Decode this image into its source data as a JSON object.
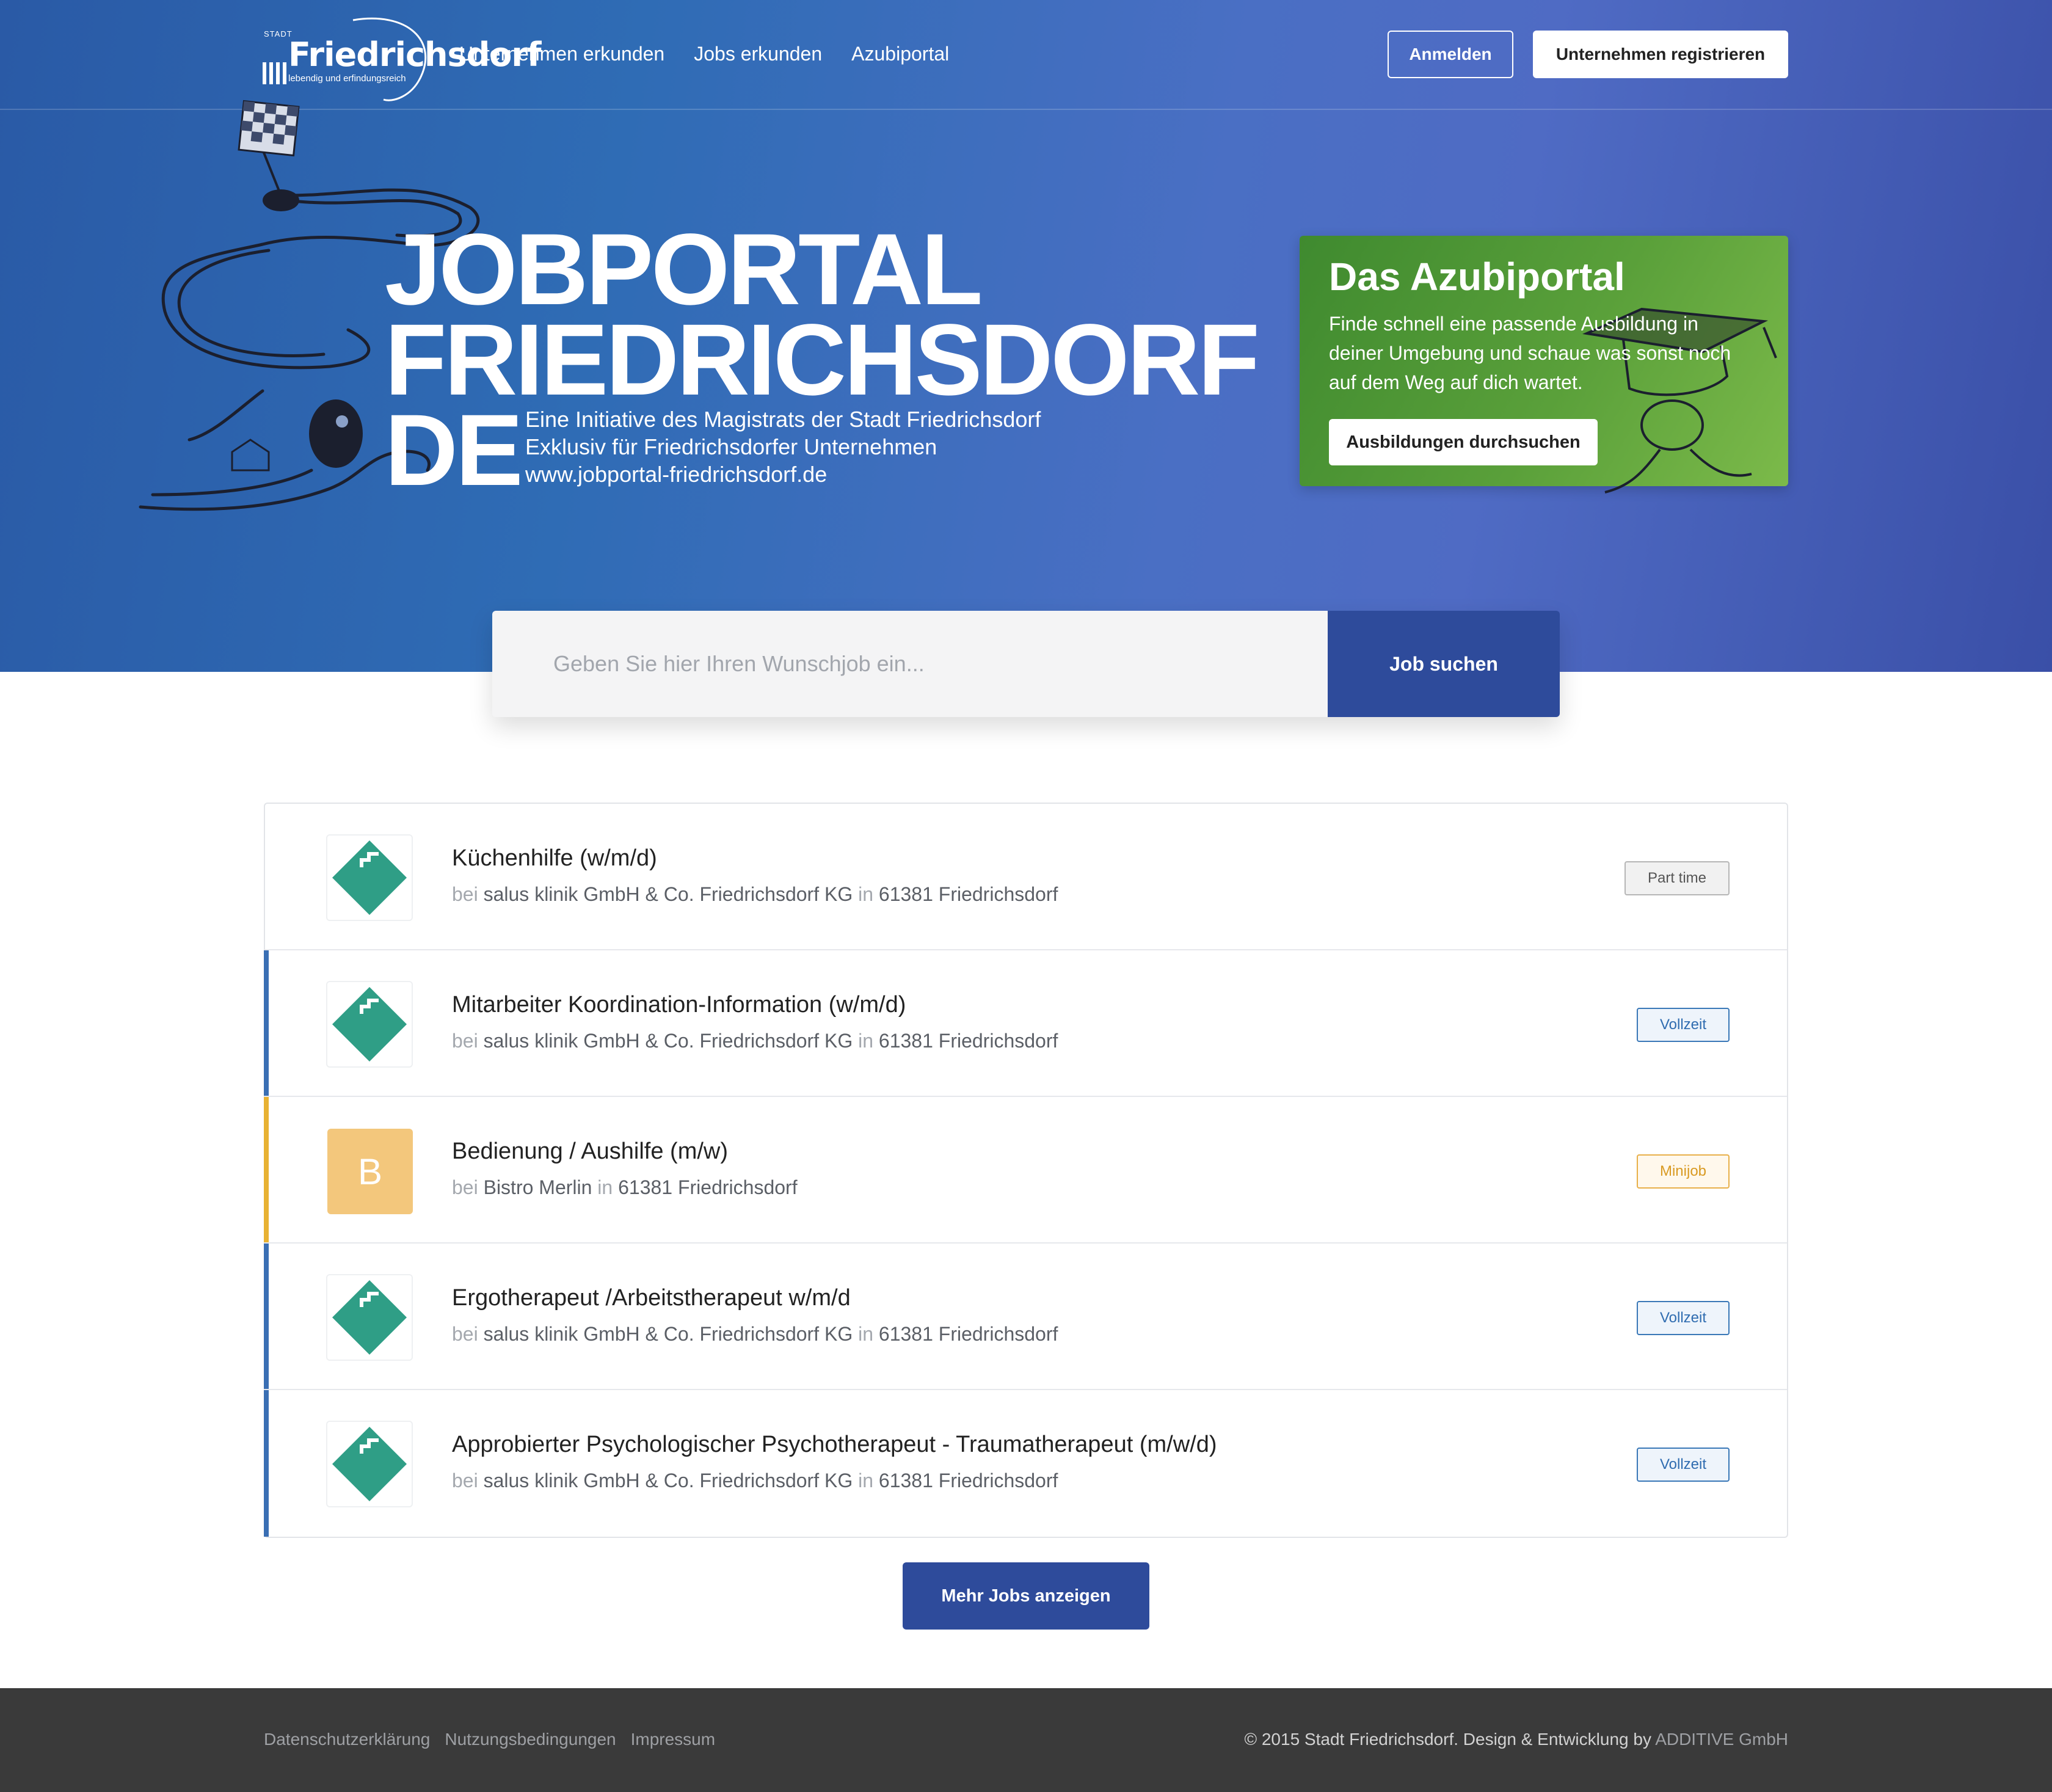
{
  "header": {
    "logo": {
      "stadt": "STADT",
      "name": "Friedrichsdorf",
      "tagline": "lebendig und erfindungsreich"
    },
    "nav": [
      "Unternehmen erkunden",
      "Jobs erkunden",
      "Azubiportal"
    ],
    "login_label": "Anmelden",
    "register_label": "Unternehmen registrieren"
  },
  "hero": {
    "title_lines": [
      "JOBPORTAL",
      "FRIEDRICHSDORF",
      "DE"
    ],
    "subtitle_lines": [
      "Eine Initiative des Magistrats der Stadt Friedrichsdorf",
      "Exklusiv für Friedrichsdorfer Unternehmen",
      "www.jobportal-friedrichsdorf.de"
    ]
  },
  "azubi": {
    "title": "Das Azubiportal",
    "text": "Finde schnell eine passende Ausbildung in deiner Umgebung und schaue was sonst noch auf dem Weg auf dich wartet.",
    "button": "Ausbildungen durchsuchen"
  },
  "search": {
    "placeholder": "Geben Sie hier Ihren Wunschjob ein...",
    "value": "",
    "button": "Job suchen"
  },
  "jobs": [
    {
      "title": "Küchenhilfe (w/m/d)",
      "bei": "bei",
      "company": "salus klinik GmbH & Co. Friedrichsdorf KG",
      "in": "in",
      "location": "61381 Friedrichsdorf",
      "type": "Part time",
      "badge": "part",
      "accent": "",
      "logo": "salus-logo"
    },
    {
      "title": "Mitarbeiter Koordination-Information (w/m/d)",
      "bei": "bei",
      "company": "salus klinik GmbH & Co. Friedrichsdorf KG",
      "in": "in",
      "location": "61381 Friedrichsdorf",
      "type": "Vollzeit",
      "badge": "voll",
      "accent": "#3a6fb4",
      "logo": "salus-logo"
    },
    {
      "title": "Bedienung / Aushilfe (m/w)",
      "bei": "bei",
      "company": "Bistro Merlin",
      "in": "in",
      "location": "61381 Friedrichsdorf",
      "type": "Minijob",
      "badge": "mini",
      "accent": "#e8b233",
      "logo": "letter",
      "letter": "B"
    },
    {
      "title": "Ergotherapeut /Arbeitstherapeut w/m/d",
      "bei": "bei",
      "company": "salus klinik GmbH & Co. Friedrichsdorf KG",
      "in": "in",
      "location": "61381 Friedrichsdorf",
      "type": "Vollzeit",
      "badge": "voll",
      "accent": "#3a6fb4",
      "logo": "salus-logo"
    },
    {
      "title": "Approbierter Psychologischer Psychotherapeut - Traumatherapeut (m/w/d)",
      "bei": "bei",
      "company": "salus klinik GmbH & Co. Friedrichsdorf KG",
      "in": "in",
      "location": "61381 Friedrichsdorf",
      "type": "Vollzeit",
      "badge": "voll",
      "accent": "#3a6fb4",
      "logo": "salus-logo"
    }
  ],
  "more_button": "Mehr Jobs anzeigen",
  "footer": {
    "links": [
      "Datenschutzerklärung",
      "Nutzungsbedingungen",
      "Impressum"
    ],
    "copyright": "© 2015 Stadt Friedrichsdorf. Design & Entwicklung by",
    "company": "ADDITIVE GmbH"
  },
  "colors": {
    "primary": "#2e4b9b",
    "azubi_green": "#5aa03a",
    "salus_teal": "#2f9e86",
    "minijob": "#e8b233"
  }
}
